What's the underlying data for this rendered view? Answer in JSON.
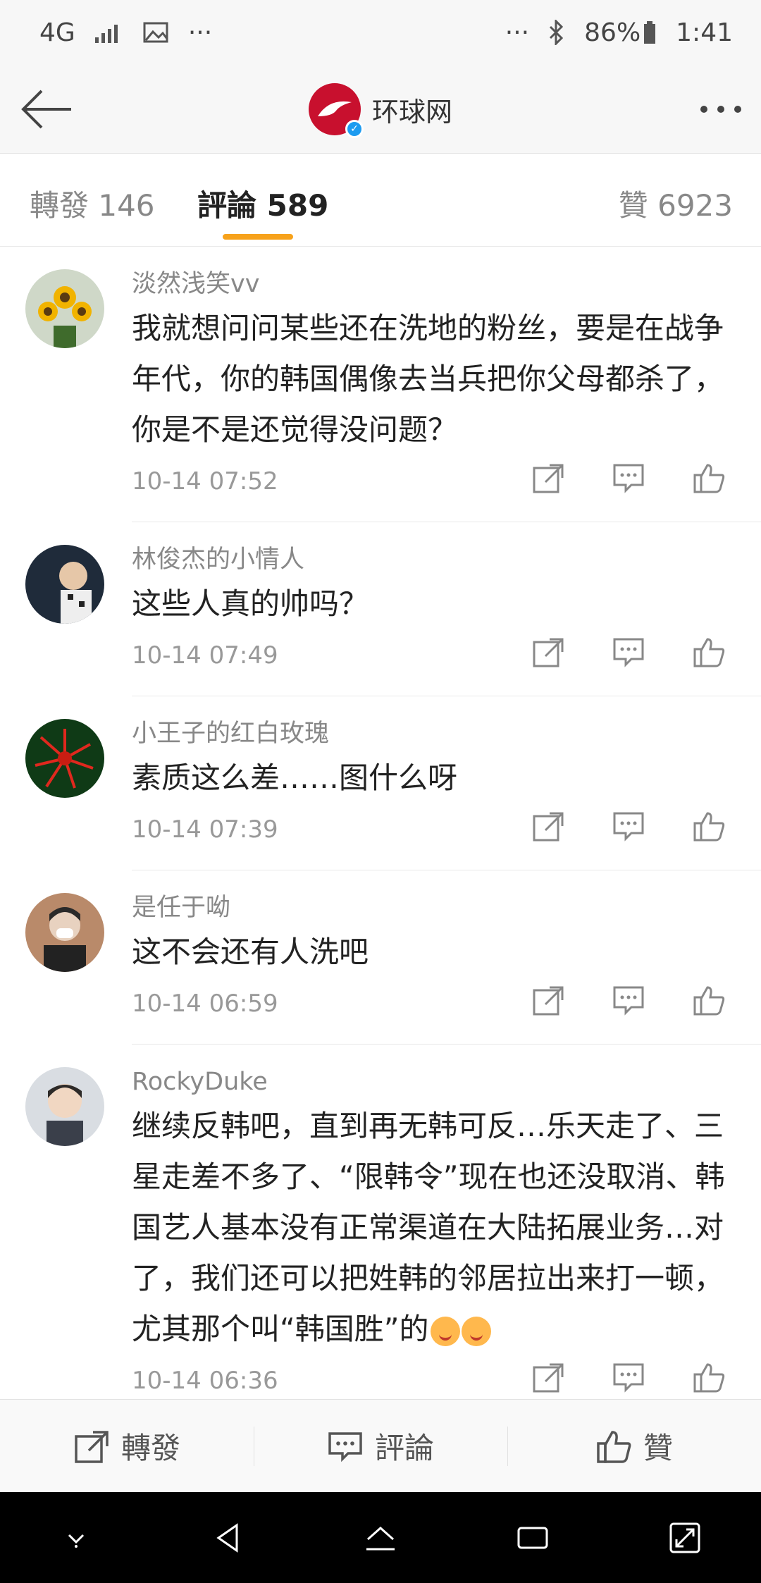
{
  "status_bar": {
    "network": "4G",
    "battery": "86%",
    "time": "1:41"
  },
  "header": {
    "title": "环球网"
  },
  "tabs": {
    "repost": "轉發 146",
    "comment": "評論 589",
    "like": "贊 6923"
  },
  "comments": [
    {
      "name": "淡然浅笑vv",
      "text": "我就想问问某些还在洗地的粉丝，要是在战争年代，你的韩国偶像去当兵把你父母都杀了，你是不是还觉得没问题？",
      "time": "10-14 07:52"
    },
    {
      "name": "林俊杰的小情人",
      "text": "这些人真的帅吗？",
      "time": "10-14 07:49"
    },
    {
      "name": "小王子的红白玫瑰",
      "text": "素质这么差……图什么呀",
      "time": "10-14 07:39"
    },
    {
      "name": "是任于呦",
      "text": "这不会还有人洗吧",
      "time": "10-14 06:59"
    },
    {
      "name": "RockyDuke",
      "text": "继续反韩吧，直到再无韩可反…乐天走了、三星走差不多了、“限韩令”现在也还没取消、韩国艺人基本没有正常渠道在大陆拓展业务…对了，我们还可以把姓韩的邻居拉出来打一顿，尤其那个叫“韩国胜”的",
      "time": "10-14 06:36"
    }
  ],
  "bottom_bar": {
    "repost": "轉發",
    "comment": "評論",
    "like": "贊"
  },
  "colors": {
    "accent": "#f7a21b",
    "logo": "#c8102e"
  }
}
